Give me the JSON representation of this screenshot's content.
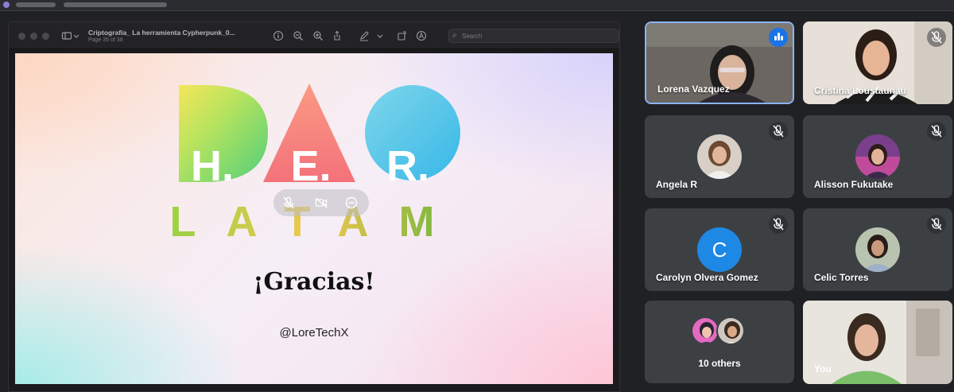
{
  "presentation": {
    "title": "Criptografía_ La herramienta Cypherpunk_0...",
    "page_indicator": "Page 35 of 38",
    "search_placeholder": "Search",
    "slide": {
      "logo_top": [
        "H.",
        "E.",
        "R."
      ],
      "logo_bottom": "LATAM",
      "heading": "¡Gracias!",
      "handle": "@LoreTechX"
    }
  },
  "participants": [
    {
      "name": "Lorena Vazquez",
      "state": "speaking"
    },
    {
      "name": "Cristina Loustaunau",
      "state": "muted"
    },
    {
      "name": "Angela R",
      "state": "muted"
    },
    {
      "name": "Alisson Fukutake",
      "state": "muted"
    },
    {
      "name": "Carolyn Olvera Gomez",
      "state": "muted",
      "initial": "C"
    },
    {
      "name": "Celic Torres",
      "state": "muted"
    }
  ],
  "others": {
    "label": "10 others"
  },
  "self": {
    "label": "You"
  },
  "colors": {
    "background": "#202124",
    "tile": "#3c4043",
    "active_border": "#8ab4f8",
    "speaking_badge": "#1a73e8",
    "avatar_c": "#1e88e5"
  },
  "icons": [
    "sidebar-icon",
    "info-icon",
    "zoom-out-icon",
    "zoom-in-icon",
    "share-icon",
    "markup-icon",
    "rotate-icon",
    "annotate-icon",
    "search-icon",
    "mic-off-icon",
    "audio-level-icon"
  ]
}
